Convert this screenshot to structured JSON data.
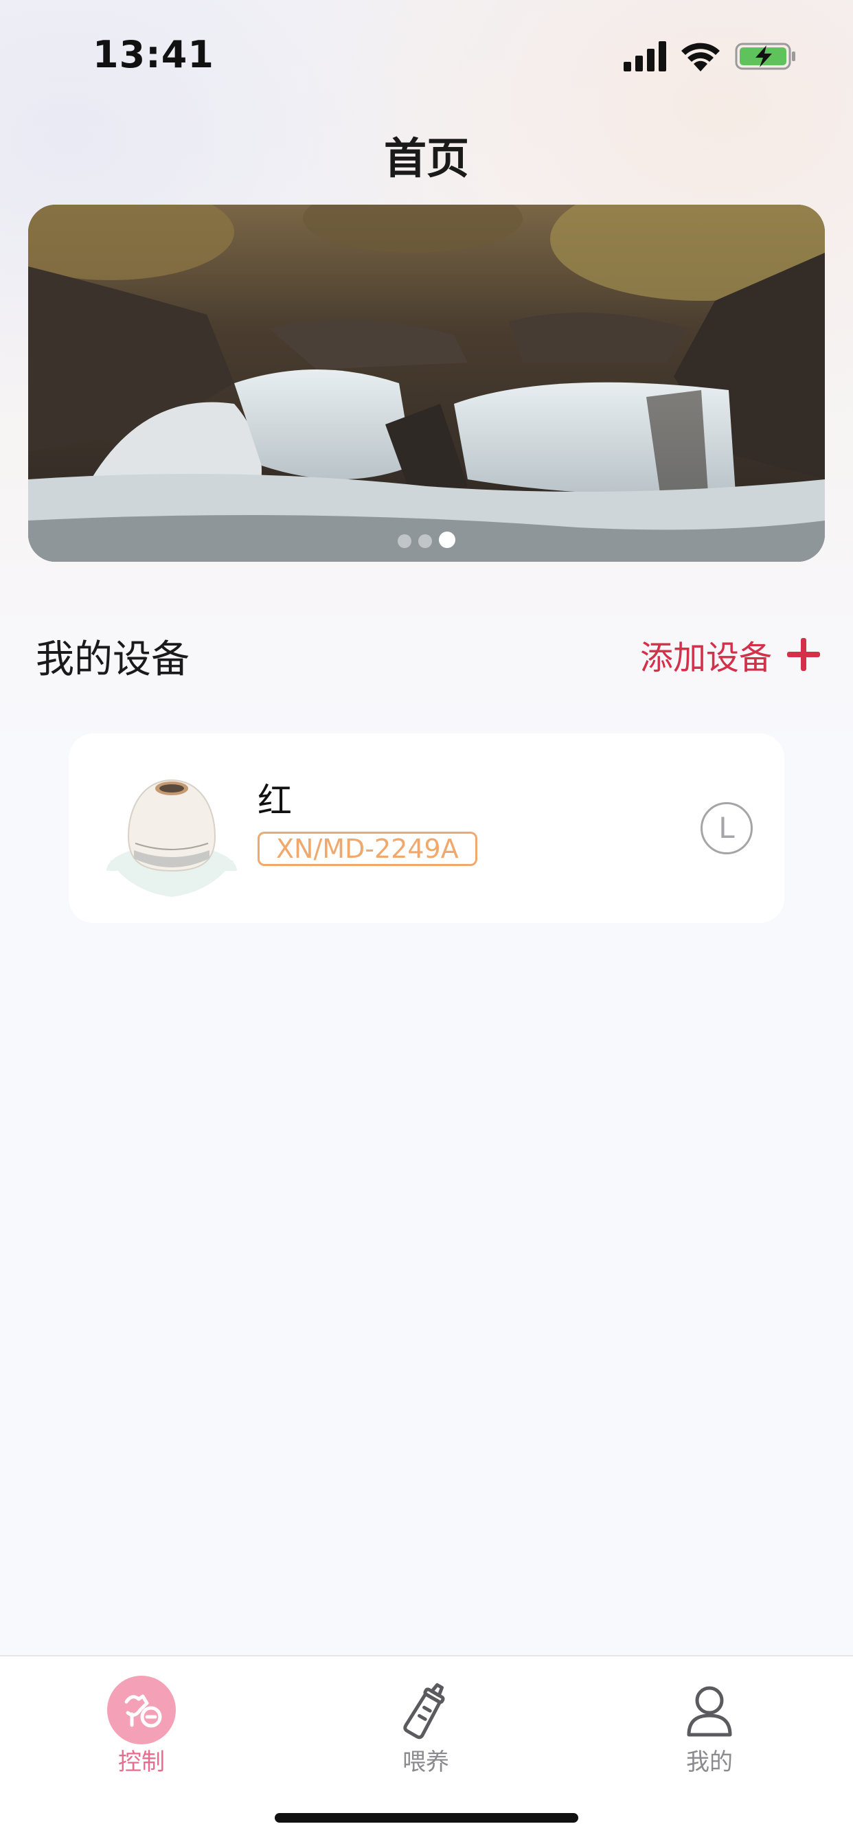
{
  "status_bar": {
    "time": "13:41",
    "icons": [
      "signal-icon",
      "wifi-icon",
      "battery-charging-icon"
    ]
  },
  "header": {
    "title": "首页"
  },
  "banner": {
    "image": "waterfall-photo",
    "page_count": 3,
    "active_index": 2
  },
  "devices_section": {
    "title": "我的设备",
    "add_label": "添加设备",
    "add_icon": "plus-icon"
  },
  "devices": [
    {
      "name": "红",
      "model": "XN/MD-2249A",
      "status_letter": "L"
    }
  ],
  "tab_bar": {
    "tabs": [
      {
        "label": "控制",
        "icon": "breast-pump-icon",
        "active": true
      },
      {
        "label": "喂养",
        "icon": "baby-bottle-icon",
        "active": false
      },
      {
        "label": "我的",
        "icon": "person-icon",
        "active": false
      }
    ]
  },
  "colors": {
    "accent": "#d3304a",
    "badge": "#f0a86c",
    "tab_active": "#ea6b8d"
  }
}
